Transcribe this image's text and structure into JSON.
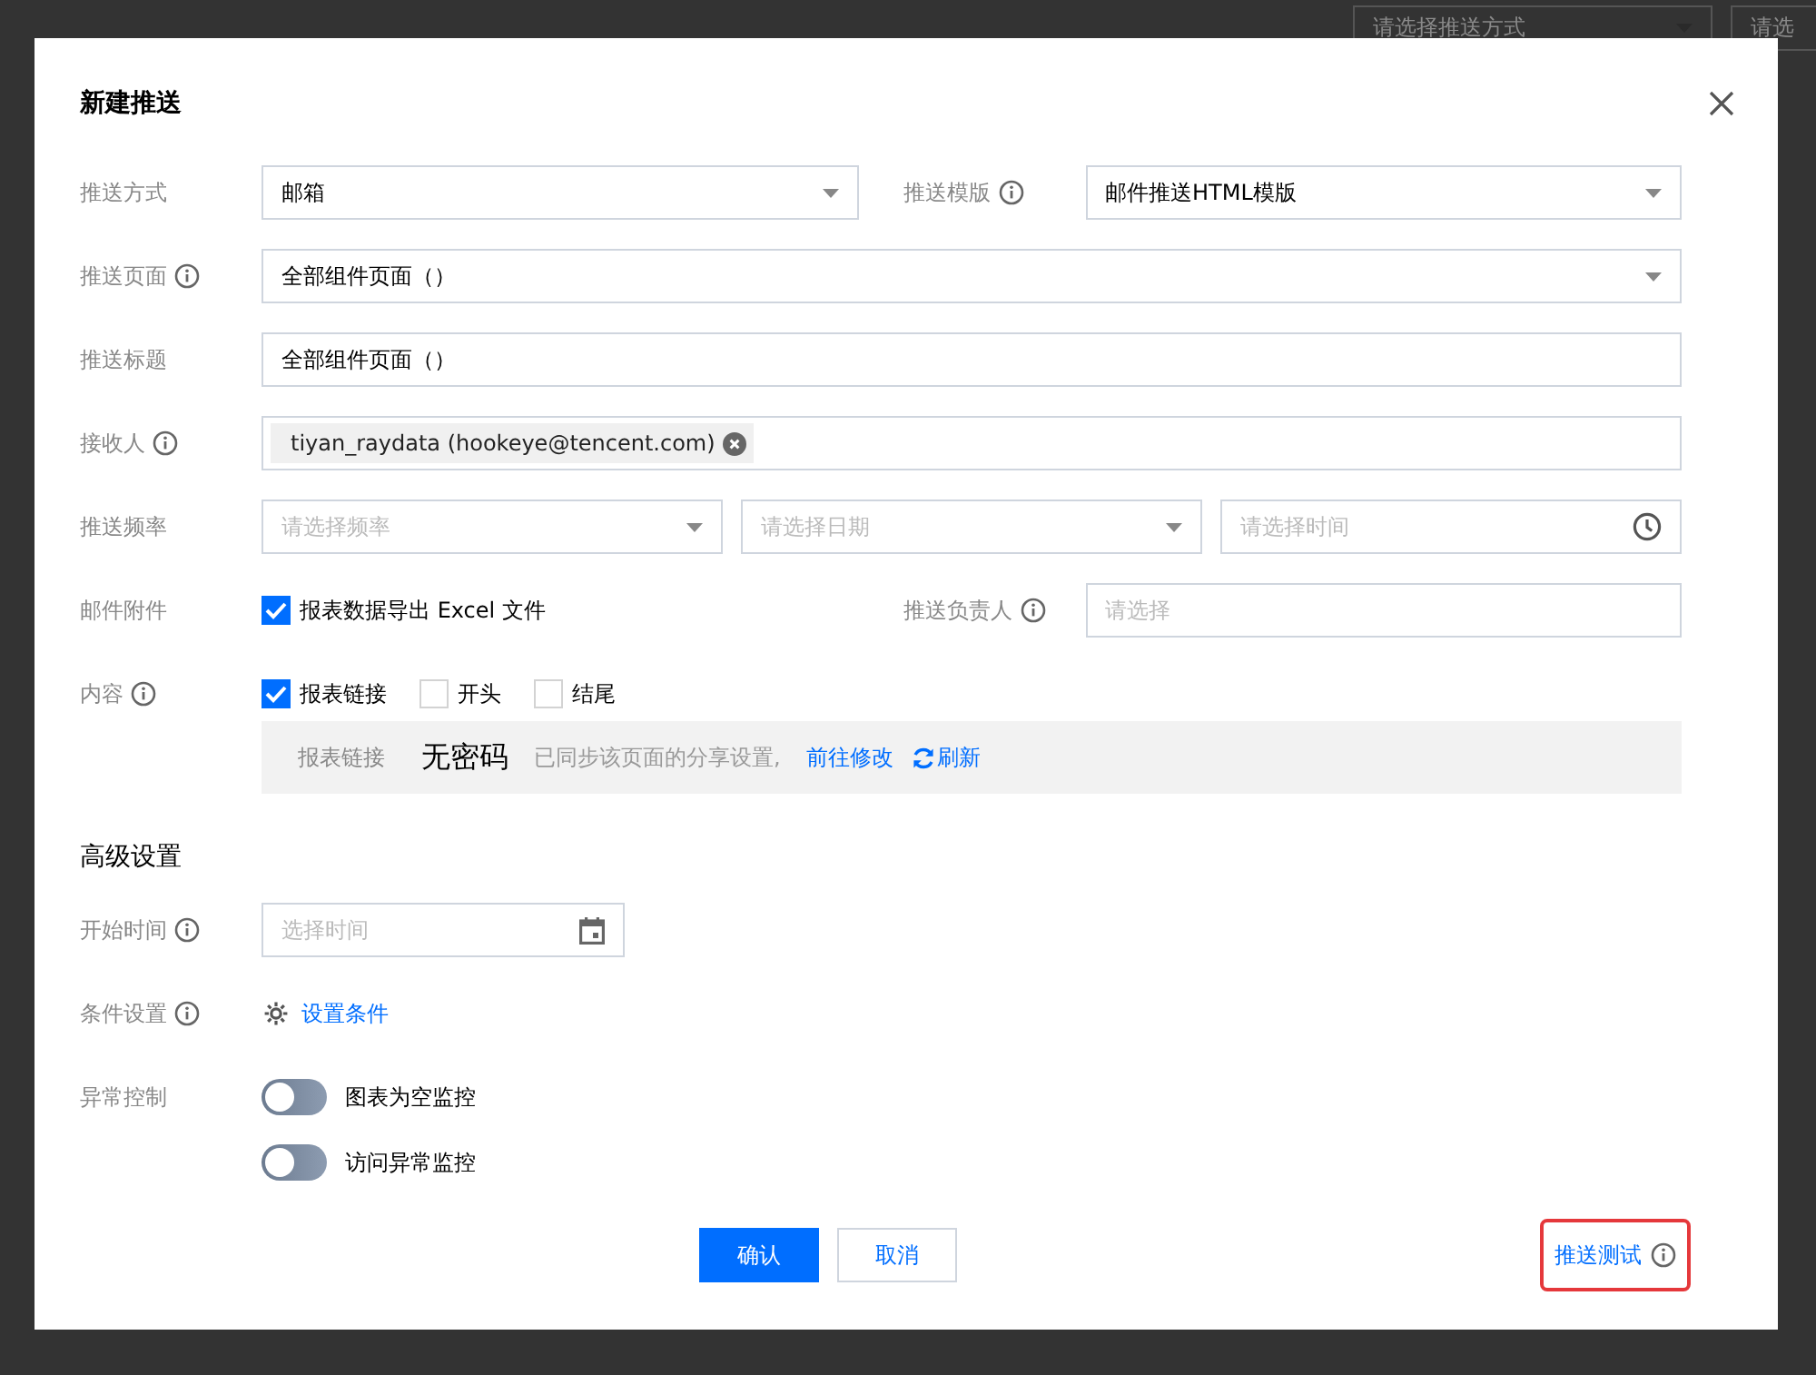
{
  "background": {
    "selects": [
      {
        "placeholder": "请选择推送方式"
      },
      {
        "placeholder": "请选"
      }
    ]
  },
  "dialog": {
    "title": "新建推送",
    "form": {
      "rows": [
        {
          "fields": [
            {
              "label": "推送方式",
              "info": false,
              "controls": [
                {
                  "kind": "select",
                  "value": "邮箱"
                }
              ]
            },
            {
              "label": "推送模版",
              "info": true,
              "controls": [
                {
                  "kind": "select",
                  "value": "邮件推送HTML模版"
                }
              ]
            }
          ]
        },
        {
          "fields": [
            {
              "label": "推送页面",
              "info": true,
              "controls": [
                {
                  "kind": "select",
                  "value": "全部组件页面（）"
                }
              ]
            }
          ]
        },
        {
          "fields": [
            {
              "label": "推送标题",
              "info": false,
              "controls": [
                {
                  "kind": "input",
                  "value": "全部组件页面（）"
                }
              ]
            }
          ]
        },
        {
          "fields": [
            {
              "label": "接收人",
              "info": true,
              "controls": [
                {
                  "kind": "tags",
                  "tags": [
                    "tiyan_raydata (hookeye@tencent.com)"
                  ]
                }
              ]
            }
          ]
        },
        {
          "fields": [
            {
              "label": "推送频率",
              "info": false,
              "controls": [
                {
                  "kind": "select",
                  "placeholder": "请选择频率"
                },
                {
                  "kind": "select",
                  "placeholder": "请选择日期"
                },
                {
                  "kind": "time",
                  "placeholder": "请选择时间"
                }
              ]
            }
          ]
        },
        {
          "fields": [
            {
              "label": "邮件附件",
              "info": false,
              "controls": [
                {
                  "kind": "checkbox",
                  "label": "报表数据导出 Excel 文件",
                  "checked": true
                }
              ]
            },
            {
              "label": "推送负责人",
              "info": true,
              "controls": [
                {
                  "kind": "input",
                  "placeholder": "请选择"
                }
              ]
            }
          ]
        },
        {
          "fields": [
            {
              "label": "内容",
              "info": true,
              "controls": [
                {
                  "kind": "checkbox",
                  "label": "报表链接",
                  "checked": true
                },
                {
                  "kind": "checkbox",
                  "label": "开头",
                  "checked": false
                },
                {
                  "kind": "checkbox",
                  "label": "结尾",
                  "checked": false
                },
                {
                  "kind": "note",
                  "label": "报表链接",
                  "value": "无密码",
                  "text": "已同步该页面的分享设置,",
                  "links": [
                    {
                      "kind": "plain",
                      "text": "前往修改"
                    },
                    {
                      "kind": "refresh",
                      "text": "刷新"
                    }
                  ]
                }
              ]
            }
          ]
        }
      ]
    },
    "advanced": {
      "heading": "高级设置",
      "rows": [
        {
          "fields": [
            {
              "label": "开始时间",
              "info": true,
              "controls": [
                {
                  "kind": "date",
                  "placeholder": "选择时间"
                }
              ]
            }
          ]
        },
        {
          "fields": [
            {
              "label": "条件设置",
              "info": true,
              "controls": [
                {
                  "kind": "link",
                  "text": "设置条件"
                }
              ]
            }
          ]
        },
        {
          "fields": [
            {
              "label": "异常控制",
              "info": false,
              "controls": [
                {
                  "kind": "toggle",
                  "label": "图表为空监控",
                  "on": false
                },
                {
                  "kind": "toggle",
                  "label": "访问异常监控",
                  "on": false
                }
              ]
            }
          ]
        }
      ]
    },
    "footer": {
      "buttons": [
        {
          "kind": "primary",
          "label": "确认"
        },
        {
          "kind": "secondary",
          "label": "取消"
        }
      ],
      "test_link": {
        "label": "推送测试",
        "info": true,
        "highlighted": true
      }
    }
  }
}
